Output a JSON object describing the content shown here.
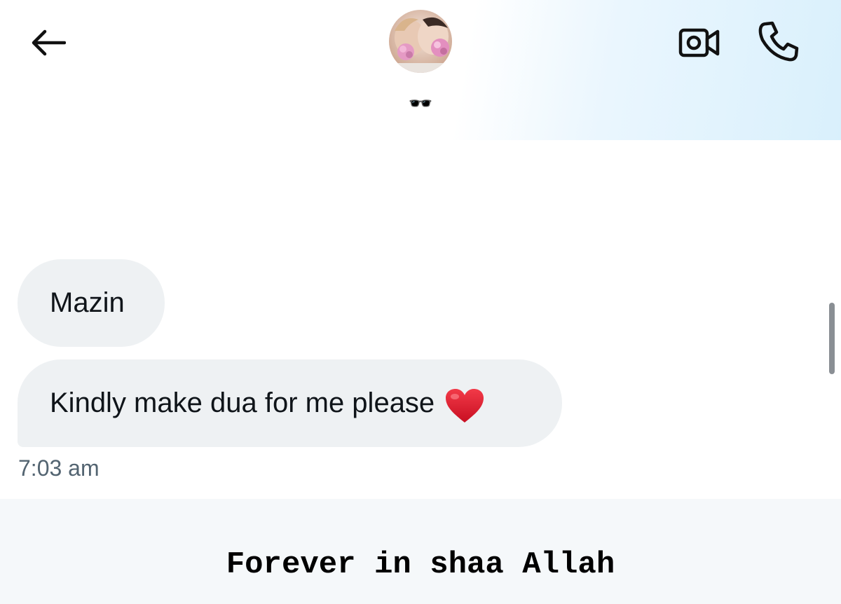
{
  "header": {
    "back_icon": "arrow-left-icon",
    "avatar_icon": "profile-photo",
    "contact_name": "🕶️",
    "video_icon": "video-camera-icon",
    "call_icon": "phone-icon",
    "gradient_color": "#d9f0fc"
  },
  "messages": [
    {
      "text": "Mazin"
    },
    {
      "text": "Kindly make dua for me please",
      "emoji_icon": "red-heart-icon"
    }
  ],
  "timestamp": "7:03 am",
  "caption": "Forever in shaa Allah",
  "colors": {
    "bubble_bg": "#eef1f3",
    "text": "#0f1419",
    "timestamp": "#536471",
    "heart": "#e0162b"
  }
}
